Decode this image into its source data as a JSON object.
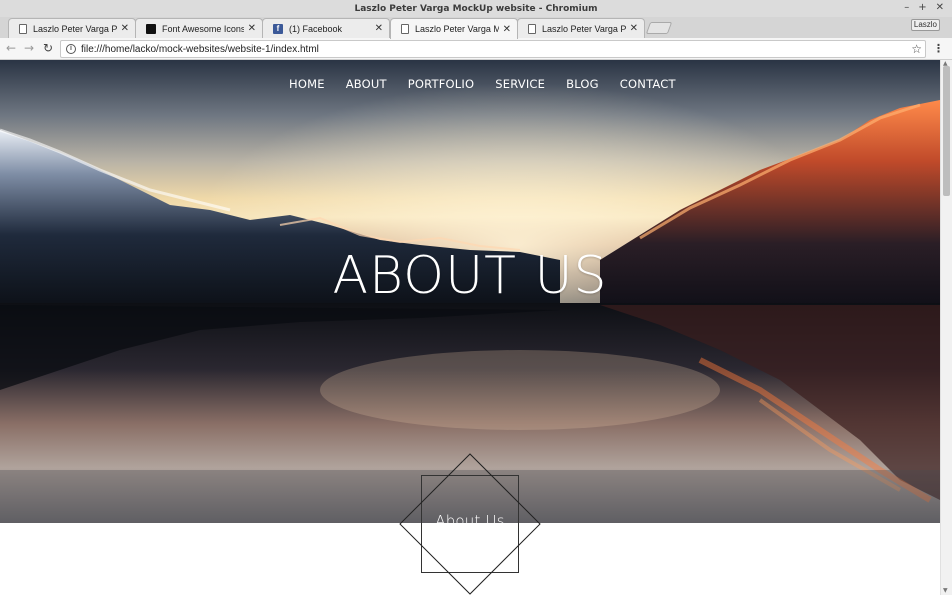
{
  "window": {
    "title": "Laszlo Peter Varga MockUp website - Chromium",
    "controls": [
      "–",
      "+",
      "✕"
    ]
  },
  "tabs": [
    {
      "label": "Laszlo Peter Varga Port",
      "favicon": "page-icon",
      "active": false
    },
    {
      "label": "Font Awesome Icons",
      "favicon": "font-awesome-icon",
      "active": false
    },
    {
      "label": "(1) Facebook",
      "favicon": "facebook-icon",
      "active": false
    },
    {
      "label": "Laszlo Peter Varga Moc",
      "favicon": "page-icon",
      "active": true
    },
    {
      "label": "Laszlo Peter Varga Port",
      "favicon": "page-icon",
      "active": false
    }
  ],
  "profile": "Laszlo",
  "toolbar": {
    "url": "file:///home/lacko/mock-websites/website-1/index.html"
  },
  "nav": {
    "items": [
      "HOME",
      "ABOUT",
      "PORTFOLIO",
      "SERVICE",
      "BLOG",
      "CONTACT"
    ]
  },
  "hero": {
    "title": "ABOUT US"
  },
  "section": {
    "heading": "About Us"
  }
}
